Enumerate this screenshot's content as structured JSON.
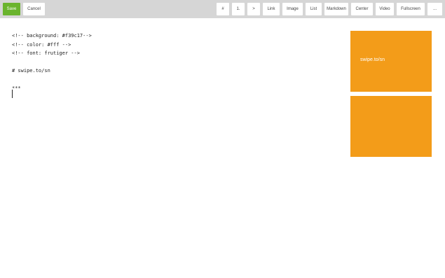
{
  "toolbar": {
    "save_label": "Save",
    "cancel_label": "Cancel",
    "buttons": [
      {
        "label": "#"
      },
      {
        "label": "1."
      },
      {
        "label": ">"
      },
      {
        "label": "Link"
      },
      {
        "label": "Image"
      },
      {
        "label": "List"
      },
      {
        "label": "Markdown"
      },
      {
        "label": "Center"
      },
      {
        "label": "Video"
      },
      {
        "label": "Fullscreen"
      },
      {
        "label": "..."
      }
    ]
  },
  "editor": {
    "lines": [
      "<!-- background: #f39c17-->",
      "<!-- color: #fff -->",
      "<!-- font: frutiger -->",
      "",
      "# swipe.to/sn",
      "",
      "***"
    ]
  },
  "preview": {
    "slides": [
      {
        "text": "swipe.to/sn"
      },
      {
        "text": ""
      }
    ]
  },
  "colors": {
    "accent": "#f39c19",
    "save": "#6ab42d",
    "toolbar_bg": "#d6d6d6"
  }
}
